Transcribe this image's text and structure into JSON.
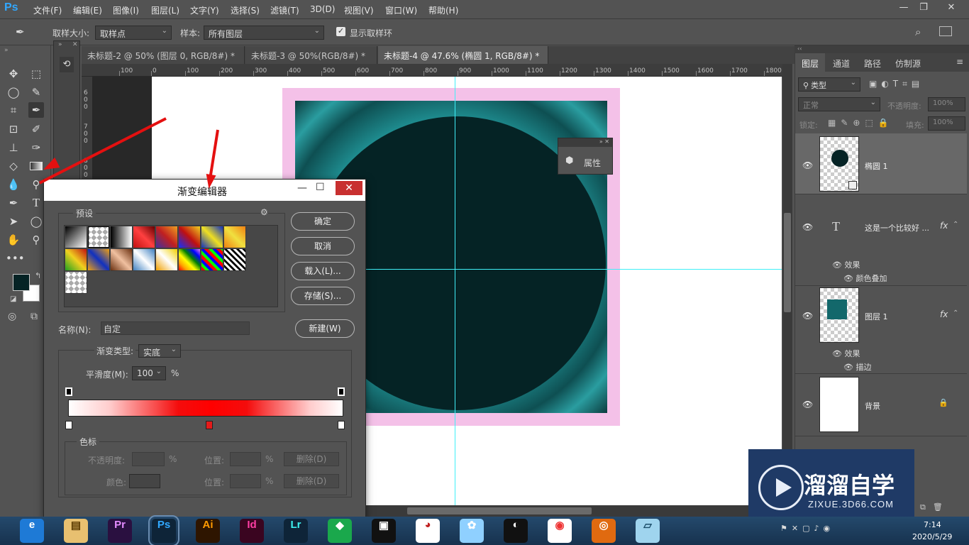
{
  "app": {
    "logo": "Ps"
  },
  "menu": [
    "文件(F)",
    "编辑(E)",
    "图像(I)",
    "图层(L)",
    "文字(Y)",
    "选择(S)",
    "滤镜(T)",
    "3D(D)",
    "视图(V)",
    "窗口(W)",
    "帮助(H)"
  ],
  "options_bar": {
    "sample_size_label": "取样大小:",
    "sample_size_value": "取样点",
    "sample_label": "样本:",
    "sample_value": "所有图层",
    "show_ring_label": "显示取样环"
  },
  "doc_tabs": [
    "未标题-2 @ 50% (图层 0, RGB/8#) *",
    "未标题-3 @ 50%(RGB/8#) *",
    "未标题-4 @ 47.6% (椭圆 1, RGB/8#) *"
  ],
  "ruler_h": [
    "100",
    "0",
    "100",
    "200",
    "300",
    "400",
    "500",
    "600",
    "700",
    "800",
    "900",
    "1000",
    "1100",
    "1200",
    "1300",
    "1400",
    "1500",
    "1600",
    "1700",
    "1800"
  ],
  "ruler_v": [
    "6 0 0",
    "7 0 0",
    "8 0 0"
  ],
  "properties_panel": {
    "label": "属性"
  },
  "panel_tabs": [
    "图层",
    "通道",
    "路径",
    "仿制源"
  ],
  "layers_panel": {
    "filter_kind": "类型",
    "blend_mode": "正常",
    "opacity_label": "不透明度:",
    "opacity_value": "100%",
    "lock_label": "锁定:",
    "fill_label": "填充:",
    "fill_value": "100%",
    "layers": [
      {
        "name": "椭圆 1"
      },
      {
        "name": "这是一个比较好 ...",
        "fx": "fx",
        "effects_label": "效果",
        "effect": "颜色叠加"
      },
      {
        "name": "图层 1",
        "fx": "fx",
        "effects_label": "效果",
        "effect": "描边"
      },
      {
        "name": "背景"
      }
    ]
  },
  "gradient_editor": {
    "title": "渐变编辑器",
    "presets_label": "预设",
    "buttons": {
      "ok": "确定",
      "cancel": "取消",
      "load": "载入(L)...",
      "save": "存储(S)...",
      "new": "新建(W)"
    },
    "name_label": "名称(N):",
    "name_value": "自定",
    "type_label": "渐变类型:",
    "type_value": "实底",
    "smooth_label": "平滑度(M):",
    "smooth_value": "100",
    "smooth_unit": "%",
    "stops_label": "色标",
    "opacity_label": "不透明度:",
    "pct": "%",
    "location_label": "位置:",
    "delete_label": "删除(D)",
    "color_label": "颜色:",
    "presets": [
      {
        "css": "linear-gradient(135deg,#000,#fff)"
      },
      {
        "css": "checker-black"
      },
      {
        "css": "linear-gradient(90deg,#000,#fff)"
      },
      {
        "css": "linear-gradient(45deg,#c01010,#ff4040,#600)"
      },
      {
        "css": "linear-gradient(45deg,#4030a0,#c02020,#f0a020)"
      },
      {
        "css": "linear-gradient(45deg,#1030ff,#c01010,#f0d020)"
      },
      {
        "css": "linear-gradient(45deg,#1030c0,#f0e020,#1030c0)"
      },
      {
        "css": "linear-gradient(45deg,#f08010,#f0e040,#f08010)"
      },
      {
        "css": "linear-gradient(45deg,#20a020,#f0d020,#c01010)"
      },
      {
        "css": "linear-gradient(45deg,#f0a010,#1030c0,#f0a010)"
      },
      {
        "css": "linear-gradient(45deg,#6a3010,#f0c0a0,#6a3010)"
      },
      {
        "css": "linear-gradient(45deg,#4080c0,#fff,#4080c0)"
      },
      {
        "css": "linear-gradient(45deg,#f0a000,#fff,#f0d000)"
      },
      {
        "css": "linear-gradient(45deg,red,orange,yellow,green,blue,violet)"
      },
      {
        "css": "repeating-linear-gradient(45deg,#f00 0 4px,#0f0 4px 8px,#00f 8px 12px)"
      },
      {
        "css": "repeating-linear-gradient(45deg,#fff 0 3px,#000 3px 6px)"
      },
      {
        "css": "checker-gray"
      }
    ],
    "ramp": "linear-gradient(90deg,#ffffff 0%,#ffcccc 15%,#f40c0c 40%,#f00 52%,#f40c0c 65%,#ffcccc 88%,#ffffff 100%)",
    "midpoint_color": "#e41a1a"
  },
  "taskbar": {
    "apps": [
      "IE",
      "Explorer",
      "Pr",
      "Ps",
      "Ai",
      "Id",
      "Lr",
      "Green",
      "Film",
      "Chart",
      "Bird",
      "QQ",
      "Chrome",
      "Fox",
      "Notebook"
    ],
    "time": "7:14",
    "date": "2020/5/29"
  },
  "watermark": {
    "brand": "溜溜自学",
    "url": "ZIXUE.3D66.COM"
  },
  "colors": {
    "accent": "#31a8ff",
    "canvas_pink": "#f4c1e8",
    "teal_dark": "#052325",
    "teal": "#1d7c80",
    "guide": "#3ff0f8",
    "arrow": "#e41010"
  }
}
